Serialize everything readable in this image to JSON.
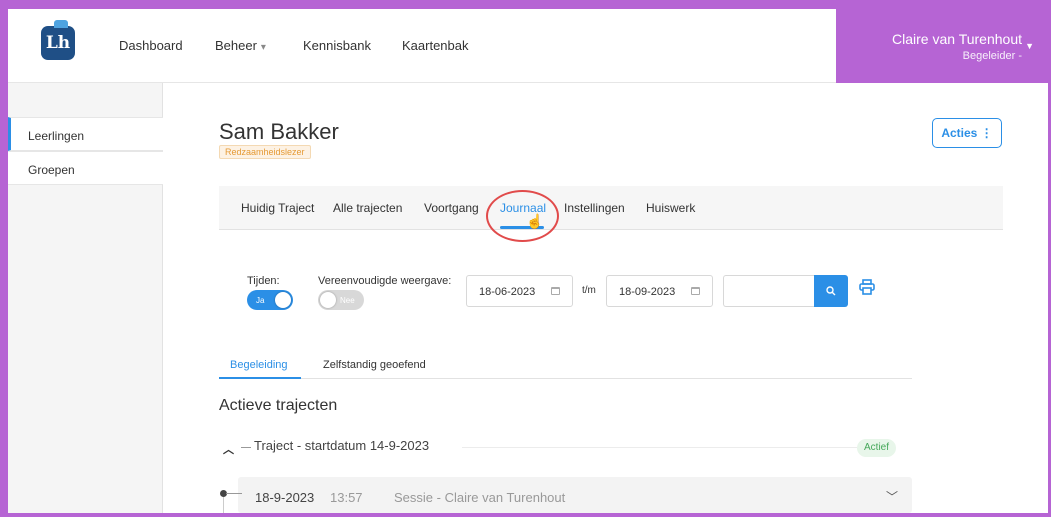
{
  "header": {
    "logo_text": "Lh",
    "nav": [
      {
        "label": "Dashboard"
      },
      {
        "label": "Beheer"
      },
      {
        "label": "Kennisbank"
      },
      {
        "label": "Kaartenbak"
      }
    ],
    "user": {
      "name": "Claire van Turenhout",
      "role": "Begeleider -"
    }
  },
  "sidebar": {
    "items": [
      {
        "label": "Leerlingen",
        "active": true
      },
      {
        "label": "Groepen",
        "active": false
      }
    ]
  },
  "student": {
    "name": "Sam Bakker",
    "badge": "Redzaamheidslezer",
    "acties_label": "Acties ⋮"
  },
  "tabs": [
    {
      "label": "Huidig Traject"
    },
    {
      "label": "Alle trajecten"
    },
    {
      "label": "Voortgang"
    },
    {
      "label": "Journaal",
      "active": true
    },
    {
      "label": "Instellingen"
    },
    {
      "label": "Huiswerk"
    }
  ],
  "filters": {
    "tijden_label": "Tijden:",
    "tijden_value": "Ja",
    "vereenvoudigd_label": "Vereenvoudigde weergave:",
    "vereenvoudigd_value": "Nee",
    "date_from": "18-06-2023",
    "tm_label": "t/m",
    "date_to": "18-09-2023",
    "search_value": ""
  },
  "subtabs": [
    {
      "label": "Begeleiding",
      "active": true
    },
    {
      "label": "Zelfstandig geoefend"
    }
  ],
  "section": {
    "title": "Actieve trajecten",
    "traject": {
      "label": "Traject - startdatum 14-9-2023",
      "status": "Actief"
    },
    "session": {
      "date": "18-9-2023",
      "time": "13:57",
      "title": "Sessie - Claire van Turenhout"
    }
  },
  "colors": {
    "accent": "#2b8fe6",
    "brand": "#b664d4",
    "active_status": "#45a85a",
    "highlight": "#e14b4b"
  }
}
